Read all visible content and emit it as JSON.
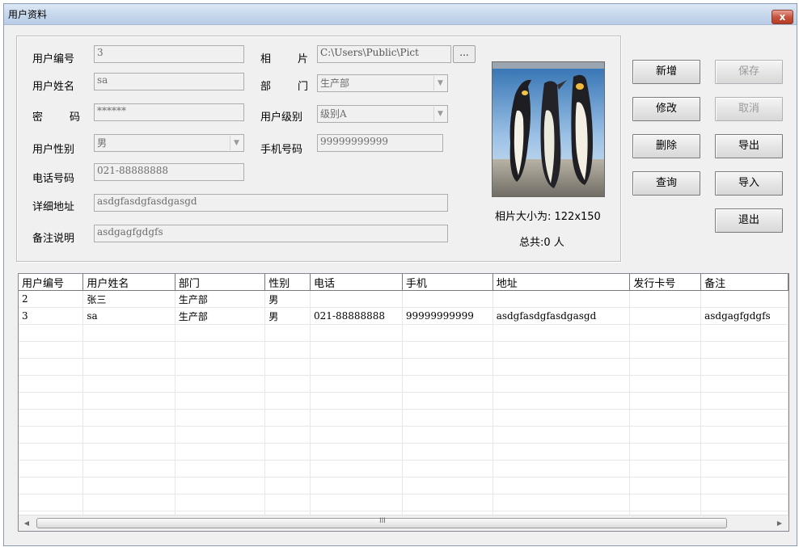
{
  "window": {
    "title": "用户资料",
    "close_label": "x"
  },
  "form": {
    "user_id": {
      "label": "用户编号",
      "value": "3"
    },
    "user_name": {
      "label": "用户姓名",
      "value": "sa"
    },
    "password": {
      "label_1": "密",
      "label_2": "码",
      "value": "******"
    },
    "gender": {
      "label": "用户性别",
      "value": "男"
    },
    "phone": {
      "label": "电话号码",
      "value": "021-88888888"
    },
    "address": {
      "label": "详细地址",
      "value": "asdgfasdgfasdgasgd"
    },
    "remark": {
      "label": "备注说明",
      "value": "asdgagfgdgfs"
    },
    "photo_path": {
      "label_1": "相",
      "label_2": "片",
      "value": "C:\\Users\\Public\\Pict",
      "browse_label": "..."
    },
    "department": {
      "label_1": "部",
      "label_2": "门",
      "value": "生产部"
    },
    "user_level": {
      "label": "用户级别",
      "value": "级别A"
    },
    "mobile": {
      "label": "手机号码",
      "value": "99999999999"
    }
  },
  "photo": {
    "size_text": "相片大小为: 122x150",
    "total_text": "总共:0 人"
  },
  "buttons": {
    "add": "新增",
    "save": "保存",
    "edit": "修改",
    "cancel": "取消",
    "delete": "删除",
    "export": "导出",
    "query": "查询",
    "import": "导入",
    "exit": "退出"
  },
  "grid": {
    "columns": [
      "用户编号",
      "用户姓名",
      "部门",
      "性别",
      "电话",
      "手机",
      "地址",
      "发行卡号",
      "备注"
    ],
    "rows": [
      [
        "2",
        "张三",
        "生产部",
        "男",
        "",
        "",
        "",
        "",
        ""
      ],
      [
        "3",
        "sa",
        "生产部",
        "男",
        "021-88888888",
        "99999999999",
        "asdgfasdgfasdgasgd",
        "",
        "asdgagfgdgfs"
      ]
    ],
    "scroll_grip": "III"
  }
}
